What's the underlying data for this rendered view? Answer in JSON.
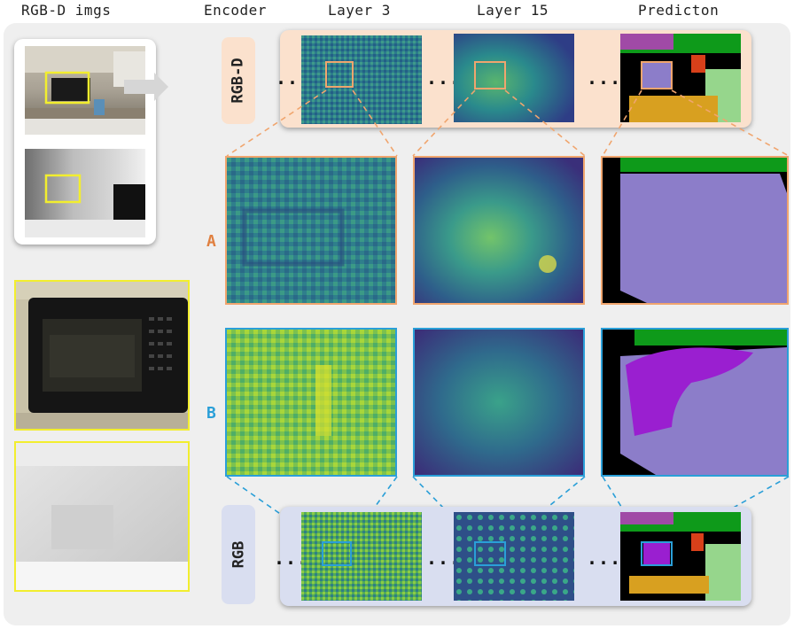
{
  "headers": {
    "col1": "RGB-D imgs",
    "col2": "Encoder",
    "col3": "Layer 3",
    "col4": "Layer 15",
    "col5": "Predicton"
  },
  "rows": {
    "top_label": "RGB-D",
    "bottom_label": "RGB",
    "a_label": "A",
    "b_label": "B",
    "dots": "..."
  },
  "colors": {
    "rgbd_accent": "#f0a56e",
    "rgb_accent": "#2a9fd8",
    "highlight_yellow": "#f2ee2e",
    "rgbd_band": "#fbe1cd",
    "rgb_band": "#d9def0"
  }
}
